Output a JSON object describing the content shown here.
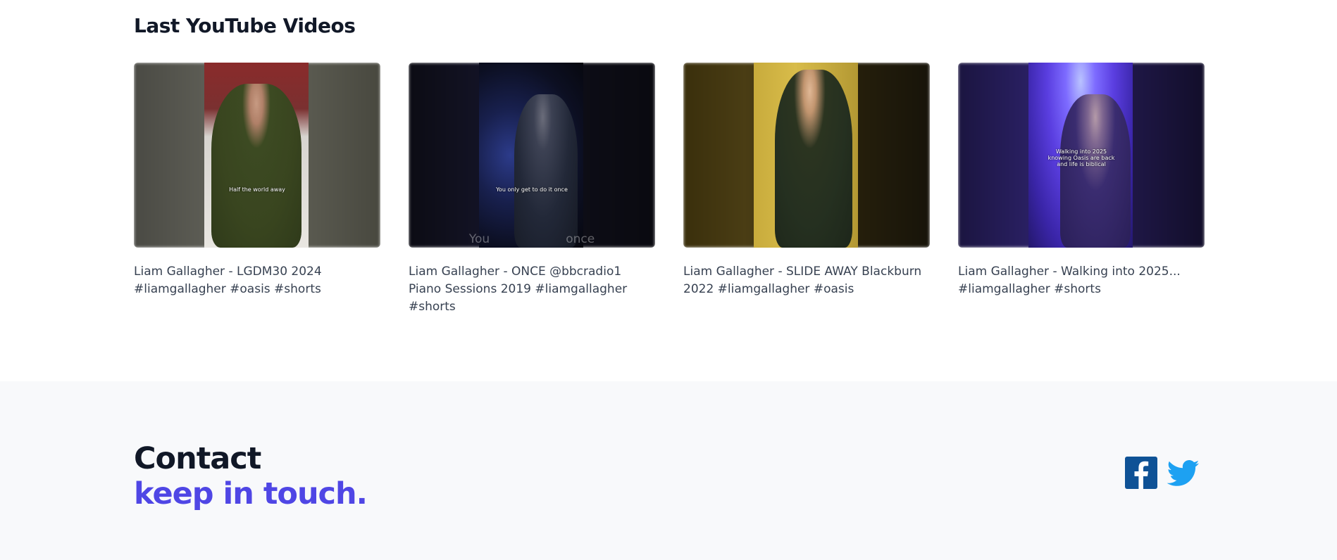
{
  "videos_section": {
    "title": "Last YouTube Videos",
    "videos": [
      {
        "title": "Liam Gallagher - LGDM30 2024 #liamgallagher #oasis #shorts",
        "thumbnail_caption": "Half the world away"
      },
      {
        "title": "Liam Gallagher - ONCE @bbcradio1 Piano Sessions 2019 #liamgallagher #shorts",
        "thumbnail_caption": "You only get to do it once",
        "thumbnail_ghost": "You                    once"
      },
      {
        "title": "Liam Gallagher - SLIDE AWAY Blackburn 2022 #liamgallagher #oasis",
        "thumbnail_caption": ""
      },
      {
        "title": "Liam Gallagher - Walking into 2025... #liamgallagher #shorts",
        "thumbnail_caption_lines": [
          "Walking into 2025",
          "knowing Oasis are back",
          "and life is biblical"
        ]
      }
    ]
  },
  "contact": {
    "heading_line1": "Contact",
    "heading_line2": "keep in touch.",
    "social": [
      {
        "name": "facebook",
        "icon": "facebook-icon",
        "color": "#0f5296"
      },
      {
        "name": "twitter",
        "icon": "twitter-icon",
        "color": "#1da1f2"
      }
    ]
  },
  "colors": {
    "accent": "#4f46e5",
    "heading": "#111827",
    "body_text": "#374151",
    "footer_bg": "#f8f9fb"
  }
}
